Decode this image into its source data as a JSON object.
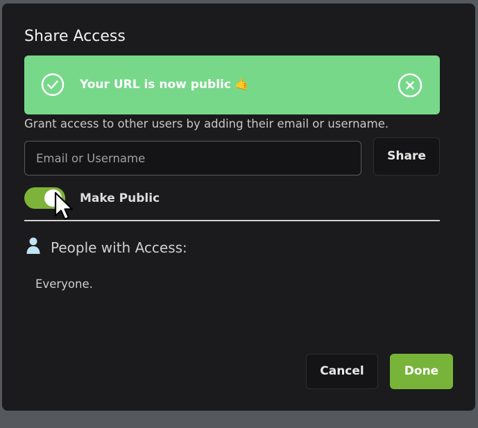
{
  "dialog": {
    "title": "Share Access"
  },
  "toast": {
    "message": "Your URL is now public 🤙",
    "status_icon": "check-circle-icon",
    "close_icon": "close-circle-icon",
    "color": "#77d88a"
  },
  "grant": {
    "instructions": "Grant access to other users by adding their email or username.",
    "input_placeholder": "Email or Username",
    "input_value": "",
    "share_label": "Share"
  },
  "visibility": {
    "toggle_on": true,
    "toggle_label": "Make Public",
    "toggle_color": "#7db339"
  },
  "access": {
    "heading": "People with Access:",
    "icon": "person-icon",
    "entries": [
      "Everyone."
    ]
  },
  "footer": {
    "cancel_label": "Cancel",
    "done_label": "Done",
    "accent": "#78b43a"
  }
}
